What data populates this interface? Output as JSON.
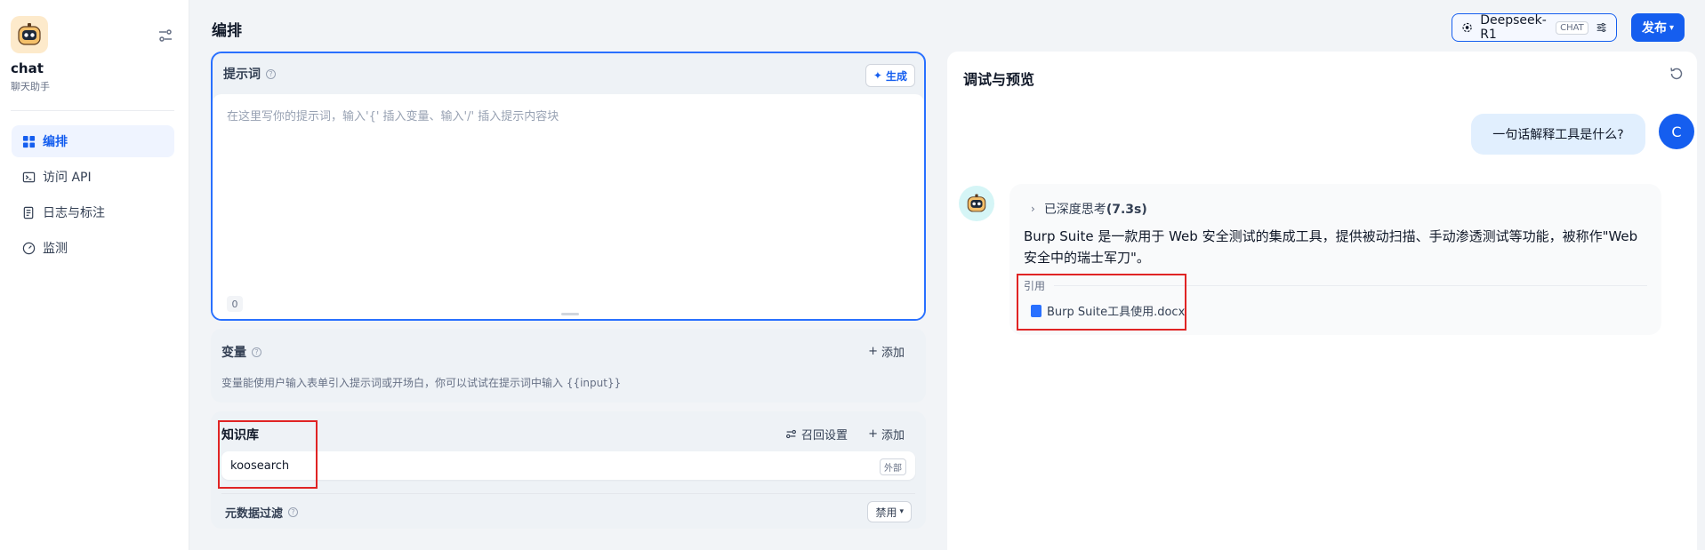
{
  "sidebar": {
    "app_name": "chat",
    "app_subtitle": "聊天助手",
    "nav": [
      {
        "label": "编排",
        "active": true
      },
      {
        "label": "访问 API"
      },
      {
        "label": "日志与标注"
      },
      {
        "label": "监测"
      }
    ]
  },
  "header": {
    "title": "编排",
    "model_name": "Deepseek-R1",
    "model_tag": "CHAT",
    "publish_label": "发布"
  },
  "prompt": {
    "title": "提示词",
    "generate_label": "生成",
    "placeholder": "在这里写你的提示词，输入'{' 插入变量、输入'/' 插入提示内容块",
    "char_count": "0"
  },
  "variables": {
    "title": "变量",
    "add_label": "添加",
    "description": "变量能使用户输入表单引入提示词或开场白，你可以试试在提示词中输入 {{input}}"
  },
  "knowledge": {
    "title": "知识库",
    "recall_label": "召回设置",
    "add_label": "添加",
    "item_name": "koosearch",
    "item_tag": "外部",
    "meta_filter_title": "元数据过滤",
    "meta_filter_value": "禁用"
  },
  "preview": {
    "title": "调试与预览",
    "user_message": "一句话解释工具是什么?",
    "user_initial": "C",
    "think_prefix": "已深度思考",
    "think_time": "(7.3s)",
    "answer": "Burp Suite 是一款用于 Web 安全测试的集成工具，提供被动扫描、手动渗透测试等功能，被称作\"Web 安全中的瑞士军刀\"。",
    "cite_label": "引用",
    "cite_file": "Burp Suite工具使用.docx"
  },
  "colors": {
    "accent": "#155eef",
    "highlight": "#e02424"
  }
}
